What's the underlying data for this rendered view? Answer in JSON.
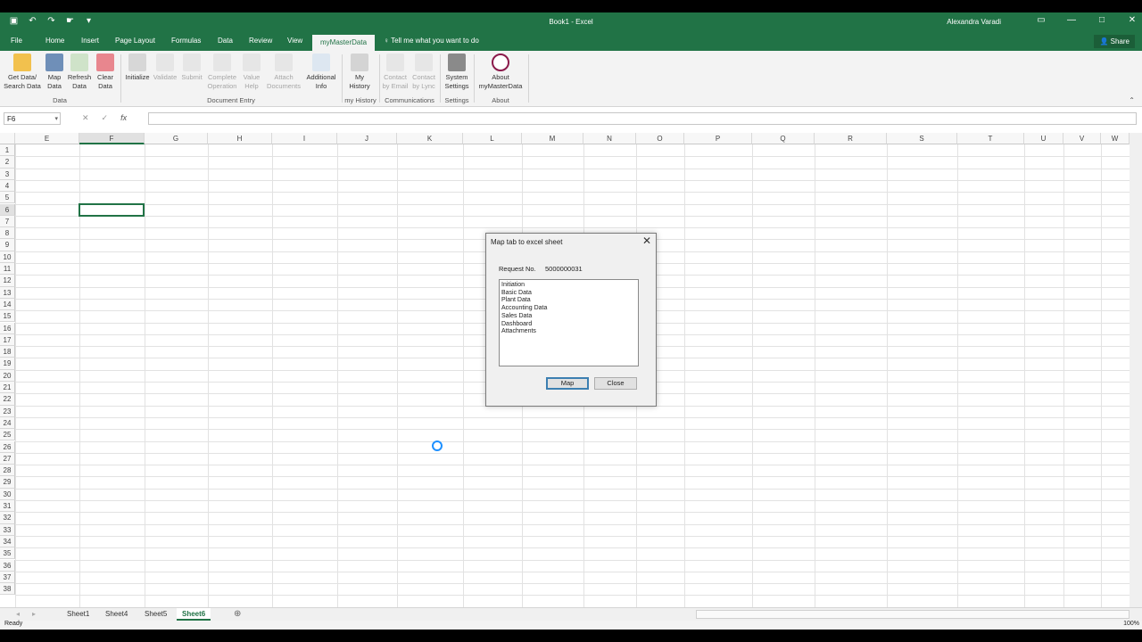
{
  "titlebar": {
    "title": "Book1 - Excel",
    "user": "Alexandra Varadi"
  },
  "tabs": [
    "File",
    "Home",
    "Insert",
    "Page Layout",
    "Formulas",
    "Data",
    "Review",
    "View",
    "myMasterData"
  ],
  "tell_me": "Tell me what you want to do",
  "share": "Share",
  "ribbon": {
    "buttons": [
      {
        "line1": "Get Data/",
        "line2": "Search Data"
      },
      {
        "line1": "Map",
        "line2": "Data"
      },
      {
        "line1": "Refresh",
        "line2": "Data"
      },
      {
        "line1": "Clear",
        "line2": "Data"
      },
      {
        "line1": "Initialize",
        "line2": ""
      },
      {
        "line1": "Validate",
        "line2": ""
      },
      {
        "line1": "Submit",
        "line2": ""
      },
      {
        "line1": "Complete",
        "line2": "Operation"
      },
      {
        "line1": "Value",
        "line2": "Help"
      },
      {
        "line1": "Attach",
        "line2": "Documents"
      },
      {
        "line1": "Additional",
        "line2": "Info"
      },
      {
        "line1": "My",
        "line2": "History"
      },
      {
        "line1": "Contact",
        "line2": "by Email"
      },
      {
        "line1": "Contact",
        "line2": "by Lync"
      },
      {
        "line1": "System",
        "line2": "Settings"
      },
      {
        "line1": "About",
        "line2": "myMasterData"
      }
    ],
    "groups": [
      "Data",
      "Document Entry",
      "my History",
      "Communications",
      "Settings",
      "About"
    ]
  },
  "formula_bar": {
    "name_box": "F6",
    "fx": "fx"
  },
  "grid": {
    "columns": [
      "E",
      "F",
      "G",
      "H",
      "I",
      "J",
      "K",
      "L",
      "M",
      "N",
      "O",
      "P",
      "Q",
      "R",
      "S",
      "T",
      "U",
      "V",
      "W"
    ],
    "rows": [
      "1",
      "2",
      "3",
      "4",
      "5",
      "6",
      "7",
      "8",
      "9",
      "10",
      "11",
      "12",
      "13",
      "14",
      "15",
      "16",
      "17",
      "18",
      "19",
      "20",
      "21",
      "22",
      "23",
      "24",
      "25",
      "26",
      "27",
      "28",
      "29",
      "30",
      "31",
      "32",
      "33",
      "34",
      "35",
      "36",
      "37",
      "38"
    ]
  },
  "dialog": {
    "title": "Map tab to excel sheet",
    "request_label": "Request No.",
    "request_value": "5000000031",
    "items": [
      "Initiation",
      "Basic Data",
      "Plant Data",
      "Accounting Data",
      "Sales Data",
      "Dashboard",
      "Attachments"
    ],
    "map_button": "Map",
    "close_button": "Close"
  },
  "sheets": [
    "Sheet1",
    "Sheet4",
    "Sheet5",
    "Sheet6"
  ],
  "active_sheet": "Sheet6",
  "status": {
    "text": "Ready",
    "zoom": "100%"
  }
}
